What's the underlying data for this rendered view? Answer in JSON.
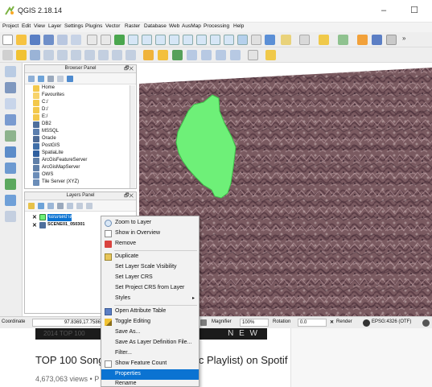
{
  "window": {
    "title": "QGIS 2.18.14",
    "minimize": "–",
    "maximize": "☐"
  },
  "menu": [
    "Project",
    "Edit",
    "View",
    "Layer",
    "Settings",
    "Plugins",
    "Vector",
    "Raster",
    "Database",
    "Web",
    "AusMap",
    "Processing",
    "Help"
  ],
  "browser_panel": {
    "title": "Browser Panel",
    "close": "🗗✕",
    "items": [
      "Home",
      "Favourites",
      "C:/",
      "D:/",
      "E:/",
      "DB2",
      "MSSQL",
      "Oracle",
      "PostGIS",
      "SpatiaLite",
      "ArcGisFeatureServer",
      "ArcGisMapServer",
      "OWS",
      "Tile Server (XYZ)"
    ]
  },
  "layers_panel": {
    "title": "Layers Panel",
    "close": "🗗✕",
    "layers": [
      {
        "name": "ขอบเขตป่าสงวนแห่งชาติ",
        "checked": true
      },
      {
        "name": "SCENE01_050301",
        "checked": true
      }
    ]
  },
  "context_menu": {
    "items": [
      {
        "label": "Zoom to Layer",
        "icon": "zoom-layer-icon"
      },
      {
        "label": "Show in Overview",
        "icon": ""
      },
      {
        "label": "Remove",
        "icon": "remove-icon"
      },
      {
        "label": "Duplicate",
        "icon": "duplicate-icon"
      },
      {
        "label": "Set Layer Scale Visibility",
        "icon": ""
      },
      {
        "label": "Set Layer CRS",
        "icon": ""
      },
      {
        "label": "Set Project CRS from Layer",
        "icon": ""
      },
      {
        "label": "Styles",
        "icon": "",
        "submenu": "▸"
      },
      {
        "label": "Open Attribute Table",
        "icon": "attribute-table-icon"
      },
      {
        "label": "Toggle Editing",
        "icon": "pencil-icon"
      },
      {
        "label": "Save As...",
        "icon": ""
      },
      {
        "label": "Save As Layer Definition File...",
        "icon": ""
      },
      {
        "label": "Filter...",
        "icon": ""
      },
      {
        "label": "Show Feature Count",
        "icon": "checkbox-icon"
      },
      {
        "label": "Properties",
        "icon": "",
        "selected": true
      },
      {
        "label": "Rename",
        "icon": ""
      }
    ]
  },
  "statusbar": {
    "coordinate_label": "Coordinate",
    "coordinate_value": "97.8369,17.7586",
    "magnifier_label": "Magnifier",
    "magnifier_value": "100%",
    "rotation_label": "Rotation",
    "rotation_value": "0.0",
    "render_label": "Render",
    "crs": "EPSG:4326 (OTF)"
  },
  "background_video": {
    "banner_text": "N E W",
    "banner_left": "2014 TOP 100",
    "title": "TOP 100 Songs",
    "title_end": "ic Playlist) on Spotif",
    "meta": "4,673,063 views • P"
  },
  "colors": {
    "polygon": "#6ef078",
    "selection": "#0b73d2",
    "layer_highlight": "#0b73d2"
  }
}
